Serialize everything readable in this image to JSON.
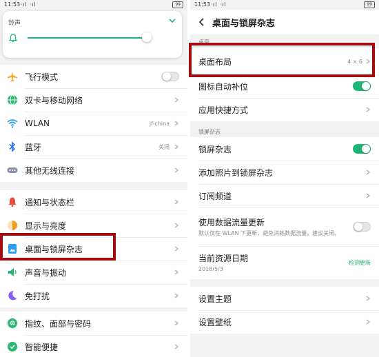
{
  "left": {
    "status": {
      "time": "11:53",
      "signal": "ᐧıl ᐧıl",
      "battery": "99"
    },
    "ringtone": {
      "label": "铃声",
      "level": 0.92
    },
    "group1": [
      {
        "icon": "airplane-icon",
        "label": "飞行模式",
        "value": "",
        "control": "toggle-off",
        "color": "#f5a623"
      },
      {
        "icon": "globe-icon",
        "label": "双卡与移动网络",
        "value": "",
        "control": "arrow",
        "color": "#2bb673"
      },
      {
        "icon": "wifi-icon",
        "label": "WLAN",
        "value": "jf-china",
        "control": "arrow",
        "color": "#2a9df4"
      },
      {
        "icon": "bluetooth-icon",
        "label": "蓝牙",
        "value": "关闭",
        "control": "arrow",
        "color": "#2a6ff4"
      },
      {
        "icon": "more-icon",
        "label": "其他无线连接",
        "value": "",
        "control": "arrow",
        "color": "#8a8fa8"
      }
    ],
    "group2": [
      {
        "icon": "notification-bell-icon",
        "label": "通知与状态栏",
        "value": "",
        "control": "arrow",
        "color": "#ef4a3c"
      },
      {
        "icon": "brightness-icon",
        "label": "显示与亮度",
        "value": "",
        "control": "arrow",
        "color": "#f29c1f"
      },
      {
        "icon": "picture-icon",
        "label": "桌面与锁屏杂志",
        "value": "",
        "control": "arrow",
        "color": "#2a9df4"
      },
      {
        "icon": "speaker-icon",
        "label": "声音与振动",
        "value": "",
        "control": "arrow",
        "color": "#2bb673"
      },
      {
        "icon": "moon-icon",
        "label": "免打扰",
        "value": "",
        "control": "arrow",
        "color": "#8a5cf6"
      }
    ],
    "group3": [
      {
        "icon": "fingerprint-icon",
        "label": "指纹、面部与密码",
        "value": "",
        "control": "arrow",
        "color": "#2bb673"
      },
      {
        "icon": "smart-icon",
        "label": "智能便捷",
        "value": "",
        "control": "arrow",
        "color": "#2bb673"
      }
    ]
  },
  "right": {
    "status": {
      "time": "11:53",
      "signal": "ᐧıl ᐧıl",
      "battery": "99"
    },
    "title": "桌面与锁屏杂志",
    "section1_label": "桌面",
    "home": {
      "layout": {
        "label": "桌面布局",
        "value": "4 × 6"
      },
      "auto_fill": {
        "label": "图标自动补位"
      },
      "shortcuts": {
        "label": "应用快捷方式"
      }
    },
    "section2_label": "锁屏杂志",
    "lock": {
      "magazine": {
        "label": "锁屏杂志"
      },
      "add_photos": {
        "label": "添加照片到锁屏杂志"
      },
      "channels": {
        "label": "订阅频道"
      },
      "mobile_data": {
        "label": "使用数据流量更新",
        "sub": "默认仅在 WLAN 下更新，避免消耗数据流量，建议关闭。"
      },
      "resource_date": {
        "label": "当前资源日期",
        "sub": "2018/5/3",
        "link": "检测更新"
      }
    },
    "theme": {
      "label": "设置主题"
    },
    "wallpaper": {
      "label": "设置壁纸"
    }
  },
  "colors": {
    "accent": "#1fb574",
    "highlight": "#a30d10"
  }
}
